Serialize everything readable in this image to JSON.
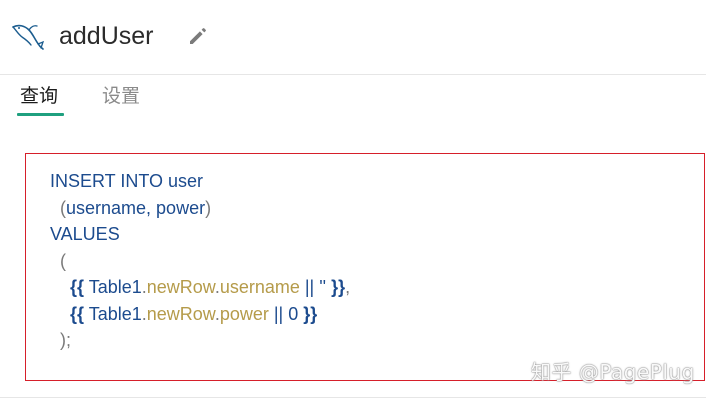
{
  "header": {
    "icon": "mysql-dolphin-icon",
    "query_name": "addUser",
    "edit_icon": "pencil-icon"
  },
  "tabs": [
    {
      "label": "查询",
      "active": true
    },
    {
      "label": "设置",
      "active": false
    }
  ],
  "colors": {
    "accent": "#1fa07f",
    "highlight_border": "#d61f2a",
    "keyword": "#1c4b8e",
    "property": "#b59b4a"
  },
  "editor": {
    "lines": [
      [
        {
          "t": "INSERT INTO user",
          "c": "kw"
        }
      ],
      [
        {
          "t": "  (",
          "c": "punct"
        },
        {
          "t": "username, power",
          "c": "plain"
        },
        {
          "t": ")",
          "c": "punct"
        }
      ],
      [
        {
          "t": "VALUES",
          "c": "kw"
        }
      ],
      [
        {
          "t": "  (",
          "c": "punct"
        }
      ],
      [
        {
          "t": "    ",
          "c": "plain"
        },
        {
          "t": "{{",
          "c": "brace"
        },
        {
          "t": " Table1",
          "c": "obj"
        },
        {
          "t": ".",
          "c": "punct"
        },
        {
          "t": "newRow",
          "c": "prop"
        },
        {
          "t": ".",
          "c": "punct"
        },
        {
          "t": "username",
          "c": "prop"
        },
        {
          "t": " || '' ",
          "c": "op"
        },
        {
          "t": "}}",
          "c": "brace"
        },
        {
          "t": ",",
          "c": "punct"
        }
      ],
      [
        {
          "t": "    ",
          "c": "plain"
        },
        {
          "t": "{{",
          "c": "brace"
        },
        {
          "t": " Table1",
          "c": "obj"
        },
        {
          "t": ".",
          "c": "punct"
        },
        {
          "t": "newRow",
          "c": "prop"
        },
        {
          "t": ".",
          "c": "punct"
        },
        {
          "t": "power",
          "c": "prop"
        },
        {
          "t": " || 0 ",
          "c": "op"
        },
        {
          "t": "}}",
          "c": "brace"
        }
      ],
      [
        {
          "t": "  );",
          "c": "punct"
        }
      ]
    ]
  },
  "watermark": "知乎 @PagePlug"
}
